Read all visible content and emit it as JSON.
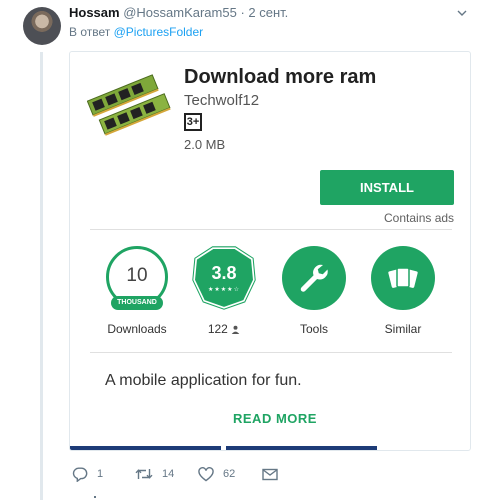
{
  "tweet": {
    "name": "Hossam",
    "handle": "@HossamKaram55",
    "separator": " · ",
    "date": "2 сент.",
    "reply_prefix": "В ответ",
    "reply_to": "@PicturesFolder"
  },
  "app_card": {
    "title": "Download more ram",
    "developer": "Techwolf12",
    "content_rating": "3+",
    "size": "2.0 MB",
    "install_label": "INSTALL",
    "contains_ads": "Contains ads",
    "stats": {
      "downloads_value": "10",
      "downloads_unit": "THOUSAND",
      "downloads_label": "Downloads",
      "rating_value": "3.8",
      "rating_stars": "★★★★☆",
      "reviews_label": "122",
      "tools_label": "Tools",
      "similar_label": "Similar"
    },
    "description": "A mobile application for fun.",
    "read_more_label": "READ MORE"
  },
  "actions": {
    "replies": "1",
    "retweets": "14",
    "likes": "62"
  },
  "colors": {
    "play_green": "#1fa463",
    "twitter_gray": "#657786",
    "twitter_blue": "#1da1f2",
    "status_strip": "#1d3b77"
  },
  "icons": [
    "caret-down-icon",
    "ram-stick-icon",
    "person-icon",
    "wrench-icon",
    "cards-icon",
    "reply-icon",
    "retweet-icon",
    "like-icon",
    "message-icon"
  ]
}
